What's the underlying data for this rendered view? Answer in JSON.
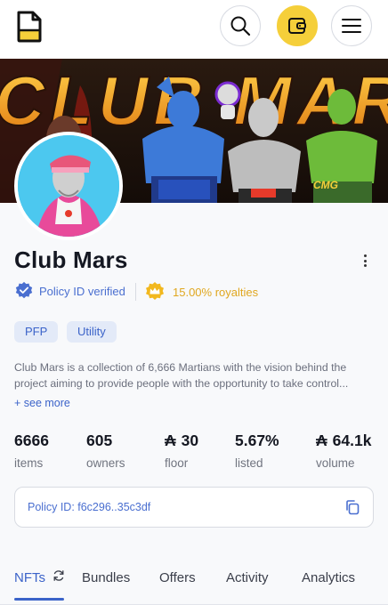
{
  "header": {
    "logo_icon": "document-logo-icon",
    "search_icon": "search-icon",
    "wallet_icon": "wallet-icon",
    "menu_icon": "hamburger-menu-icon",
    "accent_color": "#f5cf3a"
  },
  "banner": {
    "text": "CLUB MARS",
    "badge": "CMG"
  },
  "collection": {
    "name": "Club Mars",
    "policy_verified": "Policy ID verified",
    "royalties": "15.00% royalties",
    "tags": [
      "PFP",
      "Utility"
    ],
    "description_line1": "Club Mars is a collection of 6,666 Martians with the vision behind the",
    "description_line2": "project aiming to provide people with the opportunity to take control...",
    "see_more": "+ see more"
  },
  "stats": {
    "items": {
      "value": "6666",
      "label": "items"
    },
    "owners": {
      "value": "605",
      "label": "owners"
    },
    "floor": {
      "symbol": "₳",
      "value": "30",
      "label": "floor"
    },
    "listed": {
      "value": "5.67%",
      "label": "listed"
    },
    "volume": {
      "symbol": "₳",
      "value": "64.1k",
      "label": "volume"
    }
  },
  "policy": {
    "text": "Policy ID: f6c296..35c3df"
  },
  "tabs": {
    "nfts": "NFTs",
    "bundles": "Bundles",
    "offers": "Offers",
    "activity": "Activity",
    "analytics": "Analytics",
    "active_color": "#3b63c9"
  }
}
